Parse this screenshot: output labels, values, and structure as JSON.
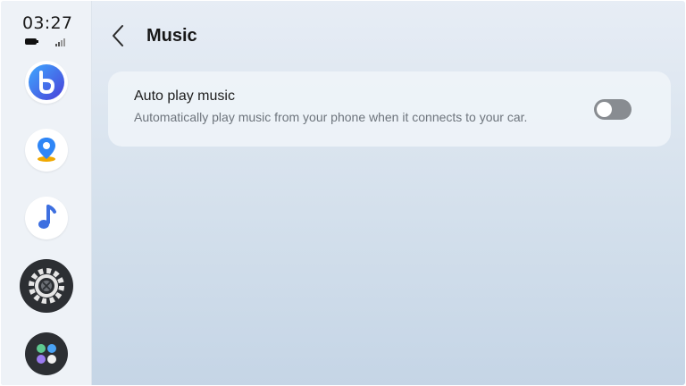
{
  "status_bar": {
    "time": "03:27"
  },
  "sidebar": {
    "apps": [
      {
        "name": "assistant"
      },
      {
        "name": "maps"
      },
      {
        "name": "music"
      },
      {
        "name": "settings"
      },
      {
        "name": "all-apps"
      }
    ]
  },
  "header": {
    "title": "Music"
  },
  "settings": {
    "auto_play": {
      "title": "Auto play music",
      "description": "Automatically play music from your phone when it connects to your car.",
      "enabled": false
    }
  },
  "colors": {
    "toggle_off": "#888c91",
    "accent_blue": "#3d6fe0",
    "dock_dark": "#2c2f33"
  }
}
